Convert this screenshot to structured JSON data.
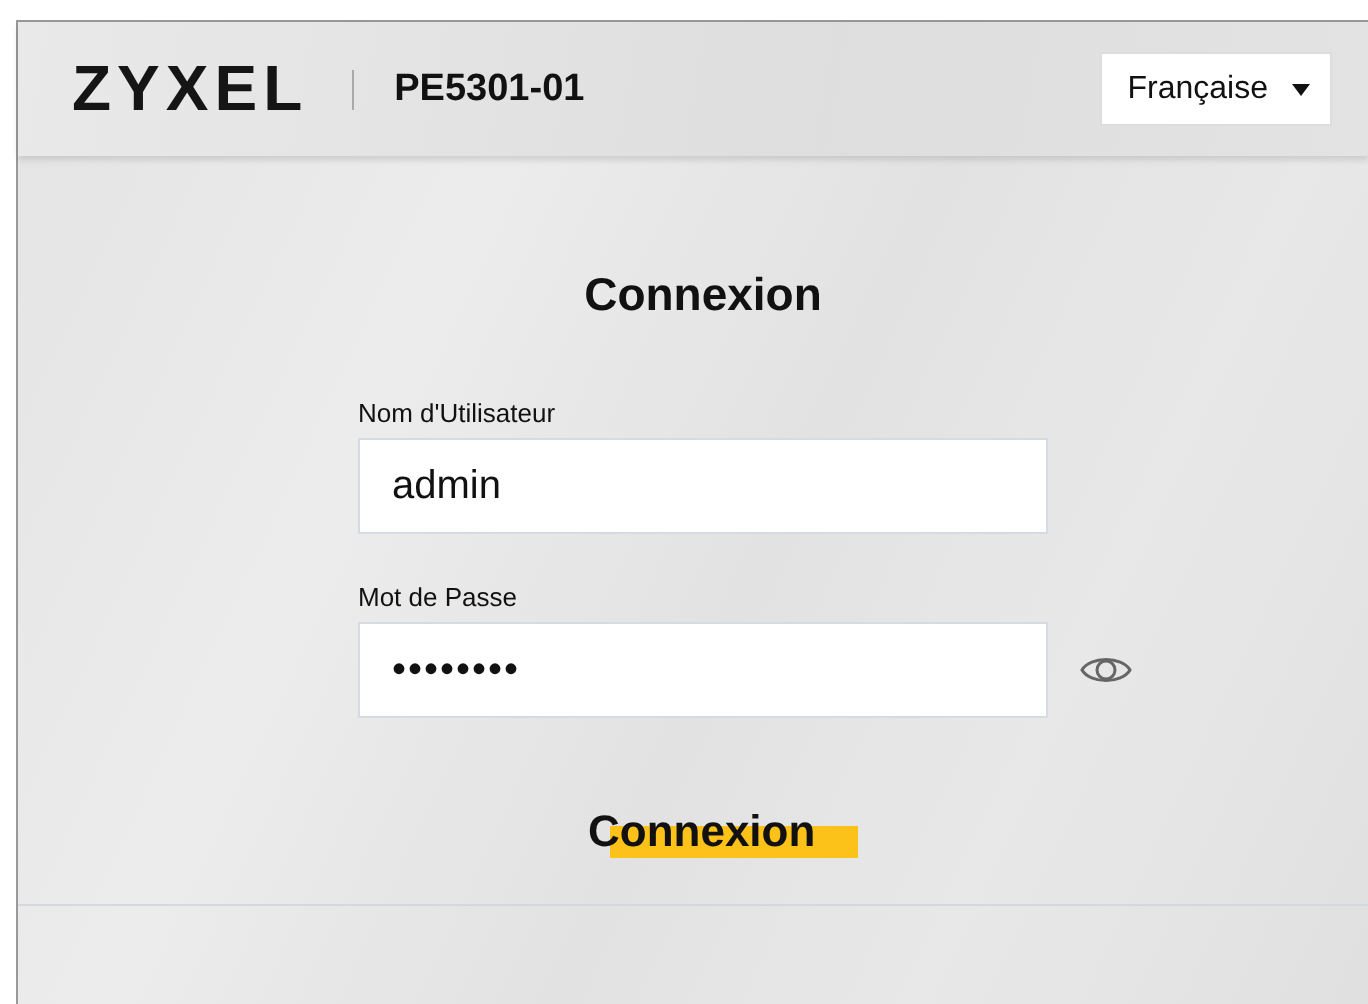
{
  "header": {
    "logo": "ZYXEL",
    "model": "PE5301-01",
    "language": {
      "value": "Française"
    }
  },
  "login": {
    "title": "Connexion",
    "fields": [
      {
        "kind": "text",
        "label": "Nom d'Utilisateur",
        "value": "admin"
      },
      {
        "kind": "password",
        "label": "Mot de Passe",
        "value": "••••••••"
      }
    ],
    "button": "Connexion"
  }
}
